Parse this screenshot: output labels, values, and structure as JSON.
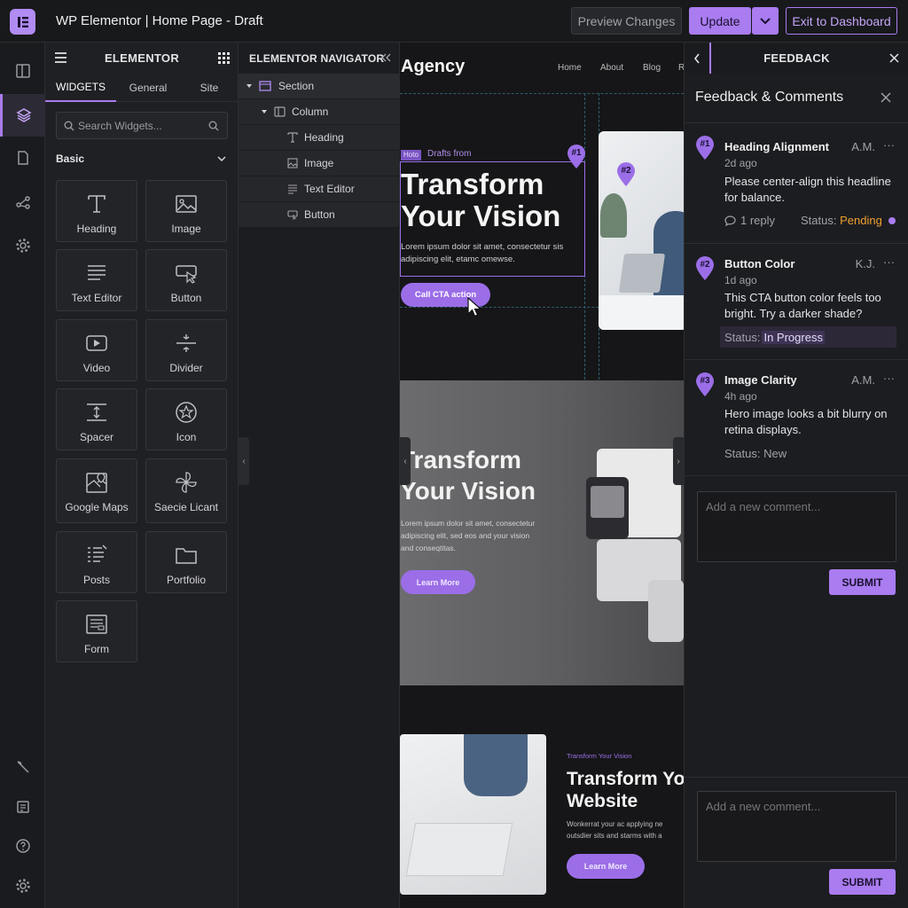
{
  "app": {
    "title": "WP Elementor | Home Page - Draft"
  },
  "toolbar": {
    "preview": "Preview Changes",
    "update": "Update",
    "exit": "Exit to Dashboard"
  },
  "panel": {
    "title": "ELEMENTOR",
    "tabs": [
      "WIDGETS",
      "General",
      "Site"
    ],
    "search_placeholder": "Search Widgets...",
    "section": "Basic",
    "widgets": [
      {
        "label": "Heading",
        "icon": "heading-icon"
      },
      {
        "label": "Image",
        "icon": "image-icon"
      },
      {
        "label": "Text Editor",
        "icon": "text-editor-icon"
      },
      {
        "label": "Button",
        "icon": "button-icon"
      },
      {
        "label": "Video",
        "icon": "video-icon"
      },
      {
        "label": "Divider",
        "icon": "divider-icon"
      },
      {
        "label": "Spacer",
        "icon": "spacer-icon"
      },
      {
        "label": "Icon",
        "icon": "star-icon"
      },
      {
        "label": "Google Maps",
        "icon": "map-icon"
      },
      {
        "label": "Saecie Licant",
        "icon": "pinwheel-icon"
      },
      {
        "label": "Posts",
        "icon": "posts-icon"
      },
      {
        "label": "Portfolio",
        "icon": "folder-icon"
      },
      {
        "label": "Form",
        "icon": "form-icon"
      }
    ]
  },
  "navigator": {
    "title": "ELEMENTOR NAVIGATOR",
    "items": [
      "Section",
      "Column",
      "Heading",
      "Image",
      "Text Editor",
      "Button"
    ]
  },
  "canvas": {
    "brand": "Agency",
    "menu": [
      "Home",
      "About",
      "Blog",
      "R"
    ],
    "badge": "Hoto",
    "kicker": "Drafts from",
    "headline_1": "Transform",
    "headline_2": "Your Vision",
    "body_1": "Lorem ipsum dolor sit amet, consectetur sis",
    "body_2": "adipiscing elit, etamc omewse.",
    "cta": "Call CTA action",
    "pins": [
      "#1",
      "#2"
    ],
    "s2_headline_1": "Transform",
    "s2_headline_2": "Your Vision",
    "s2_body_1": "Lorem ipsum dolor sit amet, consectetur",
    "s2_body_2": "adipiscing elit, sed eos and your vision",
    "s2_body_3": "and conseqtitas.",
    "s2_cta": "Learn More",
    "s3_kicker": "Transform Your Vision",
    "s3_headline_1": "Transform Yo",
    "s3_headline_2": "Website",
    "s3_body_1": "Wonkerrat your ac applying ne",
    "s3_body_2": "outsdier sits and starms with a",
    "s3_cta": "Learn More"
  },
  "feedback": {
    "header": "FEEDBACK",
    "title": "Feedback & Comments",
    "comments": [
      {
        "pin": "#1",
        "title": "Heading Alignment",
        "user": "A.M.",
        "time": "2d ago",
        "text_1": "Please center-align this headline",
        "text_2": "for balance.",
        "replies": "1 reply",
        "status_label": "Status:",
        "status": "Pending"
      },
      {
        "pin": "#2",
        "title": "Button Color",
        "user": "K.J.",
        "time": "1d ago",
        "text_1": "This CTA button color feels too",
        "text_2": "bright. Try a darker shade?",
        "status_label": "Status:",
        "status": "In Progress"
      },
      {
        "pin": "#3",
        "title": "Image Clarity",
        "user": "A.M.",
        "time": "4h ago",
        "text_1": "Hero image looks a bit blurry on",
        "text_2": "retina displays.",
        "status_label": "Status:",
        "status": "New"
      }
    ],
    "placeholder": "Add a new comment...",
    "submit": "SUBMIT",
    "more": "···"
  },
  "colors": {
    "accent": "#a97cf0",
    "pending": "#f0a030",
    "bg": "#1e1f22"
  }
}
